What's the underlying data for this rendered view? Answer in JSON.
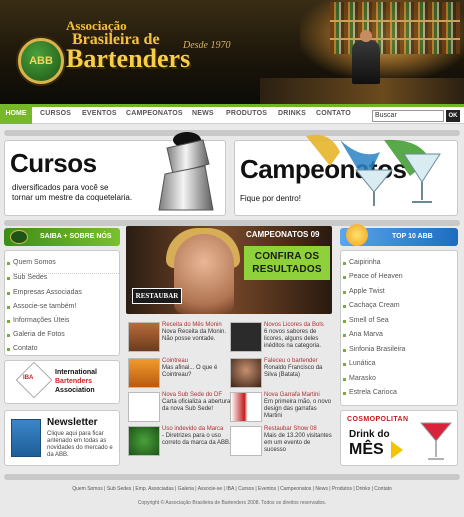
{
  "header": {
    "brand_line1": "Associação",
    "brand_line2": "Brasileira de",
    "brand_line3": "Bartenders",
    "seal_text": "ABB",
    "since": "Desde 1970"
  },
  "nav": {
    "items": [
      "HOME",
      "CURSOS",
      "EVENTOS",
      "CAMPEONATOS",
      "NEWS",
      "PRODUTOS",
      "DRINKS",
      "CONTATO"
    ],
    "active": "HOME",
    "search_placeholder": "Buscar",
    "search_button": "OK"
  },
  "promo": {
    "cursos": {
      "title": "Cursos",
      "subtitle_line1": "diversificados para você se",
      "subtitle_line2": "tornar um mestre da coquetelaria."
    },
    "campeonatos": {
      "title": "Campeonatos",
      "subtitle": "Fique por dentro!"
    }
  },
  "sidebar_left": {
    "heading": "SAIBA + SOBRE NÓS",
    "items": [
      "Quem Somos",
      "Sub Sedes",
      "Empresas Associadas",
      "Associe-se também!",
      "Informações Úteis",
      "Galeria de Fotos",
      "Contato"
    ],
    "iba": {
      "line1": "International",
      "line2": "Bartenders",
      "line3": "Association",
      "logo": "IBA"
    },
    "newsletter": {
      "title": "Newsletter",
      "text": "Clique aqui para ficar antenado em todas as novidades do mercado e da ABB."
    }
  },
  "banner": {
    "tag": "CAMPEONATOS 09",
    "headline_line1": "CONFIRA OS",
    "headline_line2": "RESULTADOS",
    "logo": "RESTAUBAR"
  },
  "news": [
    {
      "title": "Receita do Mês Monin",
      "text": "Nova Receita da Monin. Não posse vontade."
    },
    {
      "title": "Novos Licores da Bols",
      "text": "6 novos sabores de licores, alguns deles inéditos na categoria."
    },
    {
      "title": "Cointreau",
      "text": "Mas afinal... O que é Cointreau?"
    },
    {
      "title": "Faleceu o bartender",
      "text": "Ronaldo Francisco da Silva (Batata)"
    },
    {
      "title": "Nova Sub Sede do DF",
      "text": "Carta oficializa a abertura da nova Sub Sede!"
    },
    {
      "title": "Nova Garrafa Martini",
      "text": "Em primeira mão, o novo design das garrafas Martini"
    },
    {
      "title": "Uso indevido da Marca",
      "text": "- Diretrizes para o uso correto da marca da ABB."
    },
    {
      "title": "Restaubar Show 08",
      "text": "Mais de 13.200 visitantes em um evento de sucesso"
    }
  ],
  "sidebar_right": {
    "heading": "TOP 10 ABB",
    "items": [
      "Caipirinha",
      "Peace of Heaven",
      "Apple Twist",
      "Cachaça Cream",
      "Smell of Sea",
      "Ana Marva",
      "Sinfonia Brasileira",
      "Lunática",
      "Marasko",
      "Estrela Carioca"
    ],
    "drink": {
      "brand": "COSMOPOLITAN",
      "line1": "Drink do",
      "line2": "MÊS"
    }
  },
  "footer": {
    "links": "Quem Somos | Sub Sedes | Emp. Associadas | Galeria | Associe-se | IBA | Cursos | Eventos | Campeonatos | News | Produtos | Drinks | Contato",
    "copyright": "Copyright © Associação Brasileira de Bartenders 2008. Todos os direitos reservados."
  },
  "colors": {
    "accent_green": "#76b82a",
    "top10_blue": "#2a7fd0",
    "gold": "#f2c23d"
  }
}
